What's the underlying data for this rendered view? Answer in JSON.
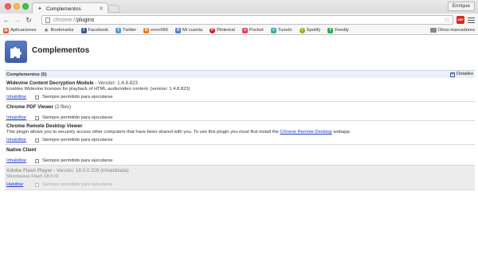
{
  "browser": {
    "tab_title": "Complementos",
    "user_button": "Enrique",
    "url_scheme": "chrome://",
    "url_path": "plugins",
    "abp_label": "ABP"
  },
  "bookmarks": [
    {
      "label": "Aplicaciones",
      "icon": "apps-grid-icon",
      "color": "#e05a2b"
    },
    {
      "label": "Bookmarks",
      "icon": "star-icon",
      "color": "#666666"
    },
    {
      "label": "Facebook",
      "icon": "facebook-icon",
      "color": "#3b5998"
    },
    {
      "label": "Twitter",
      "icon": "twitter-icon",
      "color": "#4aa3df"
    },
    {
      "label": "error066",
      "icon": "blogger-icon",
      "color": "#f57d00"
    },
    {
      "label": "Mi cuenta",
      "icon": "google-icon",
      "color": "#4a7ee0"
    },
    {
      "label": "Pinterest",
      "icon": "pinterest-icon",
      "color": "#cb2027"
    },
    {
      "label": "Pocket",
      "icon": "pocket-icon",
      "color": "#ee4056"
    },
    {
      "label": "TuneIn",
      "icon": "tunein-icon",
      "color": "#36b4a7"
    },
    {
      "label": "Spotify",
      "icon": "spotify-icon",
      "color": "#84bd00"
    },
    {
      "label": "Feedly",
      "icon": "feedly-icon",
      "color": "#2bb24c"
    }
  ],
  "bookmarks_other": "Otros marcadores",
  "page": {
    "title": "Complementos",
    "section_title": "Complementos (5)",
    "details_label": "Detalles"
  },
  "plugins": [
    {
      "name": "Widevine Content Decryption Module",
      "version": " - Versión: 1.4.8.823",
      "description": "Enables Widevine licenses for playback of HTML audio/video content. (version: 1.4.8.823)",
      "action": "Inhabilitar",
      "checkbox_label": "Siempre permitido para ejecutarse"
    },
    {
      "name": "Chrome PDF Viewer",
      "version": " (2 files)",
      "description": "",
      "action": "Inhabilitar",
      "checkbox_label": "Siempre permitido para ejecutarse"
    },
    {
      "name": "Chrome Remote Desktop Viewer",
      "version": "",
      "description": "This plugin allows you to securely access other computers that have been shared with you. To use this plugin you must first install the ",
      "description_link": "Chrome Remote Desktop",
      "description_suffix": " webapp.",
      "action": "Inhabilitar",
      "checkbox_label": "Siempre permitido para ejecutarse"
    },
    {
      "name": "Native Client",
      "version": "",
      "description": "",
      "action": "Inhabilitar",
      "checkbox_label": "Siempre permitido para ejecutarse"
    },
    {
      "name": "Adobe Flash Player",
      "version": " - Versión: 18.0.0.209 (Inhabilitada)",
      "description": "Shockwave Flash 18.0 r0",
      "action": "Habilitar",
      "checkbox_label": "Siempre permitido para ejecutarse"
    }
  ]
}
